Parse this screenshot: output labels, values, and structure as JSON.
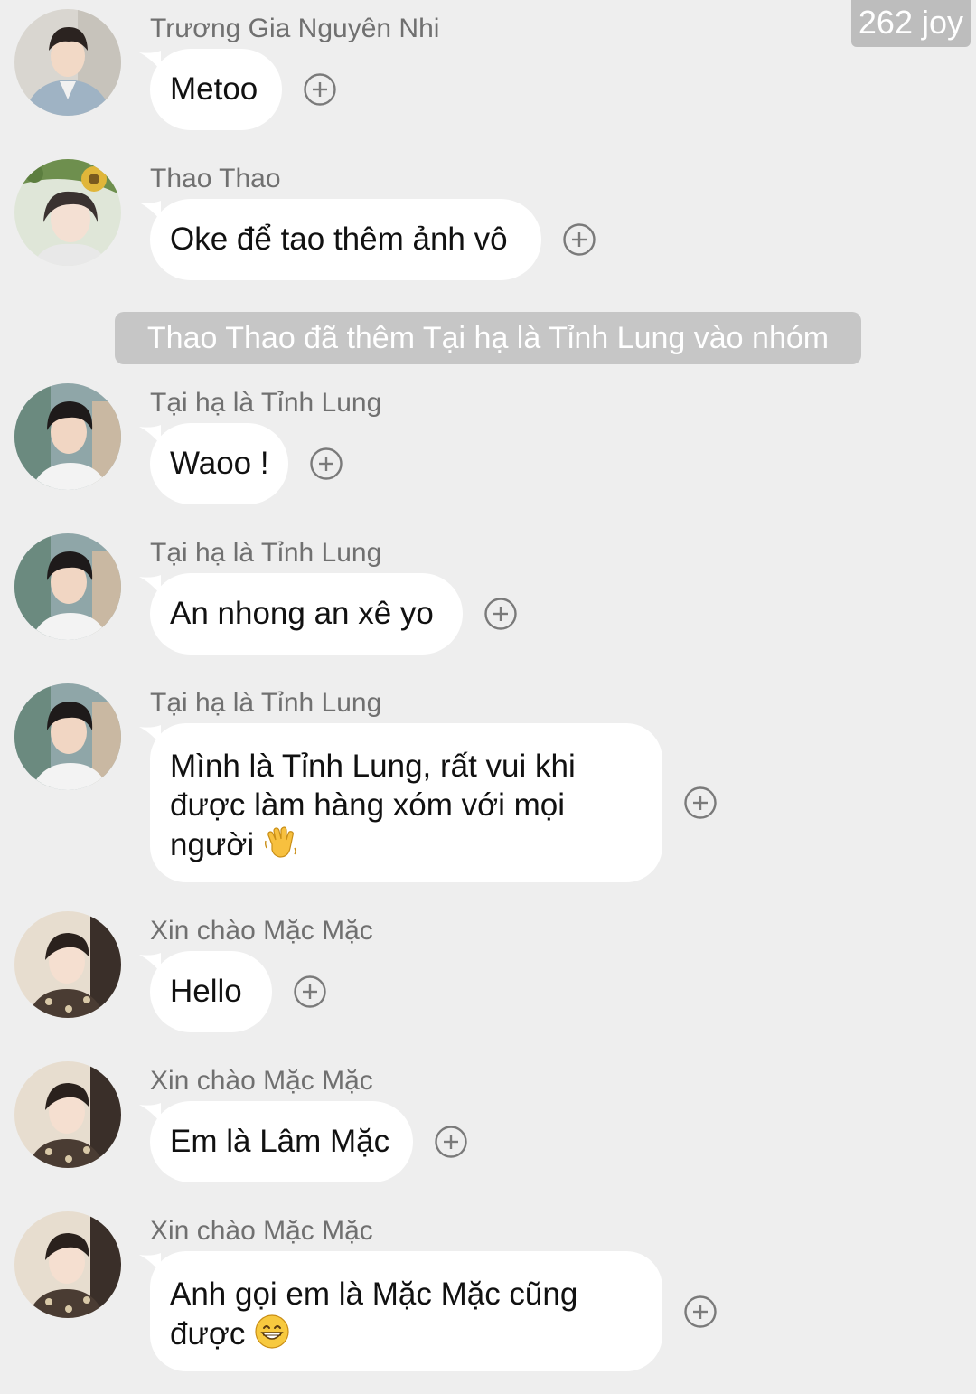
{
  "watermark": "262 joy",
  "system_notice": "Thao Thao đã thêm Tại hạ là Tỉnh Lung vào nhóm",
  "messages": [
    {
      "sender": "Trương Gia Nguyên Nhi",
      "text": "Metoo",
      "avatar": "avatar-blue-suit"
    },
    {
      "sender": "Thao Thao",
      "text": "Oke để tao thêm ảnh vô",
      "avatar": "avatar-sunflower"
    },
    {
      "sender": "Tại hạ là Tỉnh Lung",
      "text": "Waoo !",
      "avatar": "avatar-white-shirt"
    },
    {
      "sender": "Tại hạ là Tỉnh Lung",
      "text": "An nhong an xê yo",
      "avatar": "avatar-white-shirt"
    },
    {
      "sender": "Tại hạ là Tỉnh Lung",
      "text": "Mình là Tỉnh Lung, rất vui khi được làm hàng xóm với mọi người",
      "emoji": "waving-hand",
      "avatar": "avatar-white-shirt"
    },
    {
      "sender": "Xin chào Mặc Mặc",
      "text": "Hello",
      "avatar": "avatar-patterned-shirt"
    },
    {
      "sender": "Xin chào Mặc Mặc",
      "text": "Em là Lâm Mặc",
      "avatar": "avatar-patterned-shirt"
    },
    {
      "sender": "Xin chào Mặc Mặc",
      "text": "Anh gọi em là Mặc Mặc cũng được",
      "emoji": "grinning-face",
      "avatar": "avatar-patterned-shirt"
    }
  ],
  "reaction_icon": "add-reaction-icon",
  "colors": {
    "background": "#eeeeee",
    "bubble": "#ffffff",
    "notice_bg": "#c6c6c6",
    "sender_text": "#707070"
  }
}
